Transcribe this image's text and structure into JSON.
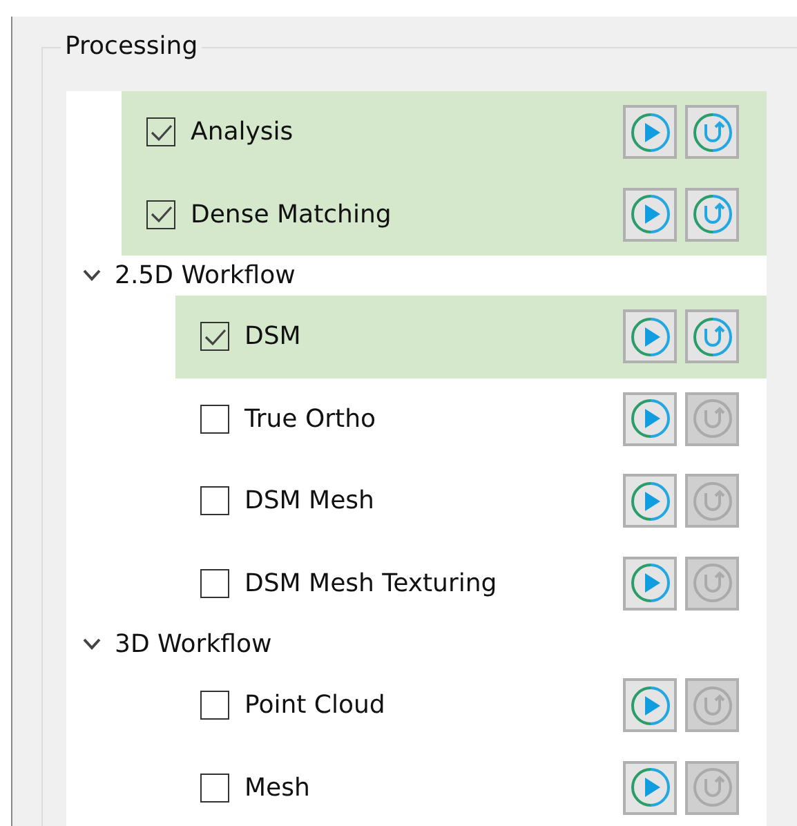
{
  "group_title": "Processing",
  "tree": [
    {
      "kind": "step",
      "label": "Analysis",
      "checked": true,
      "reset_disabled": false
    },
    {
      "kind": "step",
      "label": "Dense Matching",
      "checked": true,
      "reset_disabled": false
    },
    {
      "kind": "group",
      "label": "2.5D Workflow",
      "expanded": true,
      "children": [
        {
          "kind": "step",
          "label": "DSM",
          "checked": true,
          "reset_disabled": false
        },
        {
          "kind": "step",
          "label": "True Ortho",
          "checked": false,
          "reset_disabled": true
        },
        {
          "kind": "step",
          "label": "DSM Mesh",
          "checked": false,
          "reset_disabled": true
        },
        {
          "kind": "step",
          "label": "DSM Mesh Texturing",
          "checked": false,
          "reset_disabled": true
        }
      ]
    },
    {
      "kind": "group",
      "label": "3D Workflow",
      "expanded": true,
      "children": [
        {
          "kind": "step",
          "label": "Point Cloud",
          "checked": false,
          "reset_disabled": true
        },
        {
          "kind": "step",
          "label": "Mesh",
          "checked": false,
          "reset_disabled": true
        }
      ]
    }
  ]
}
